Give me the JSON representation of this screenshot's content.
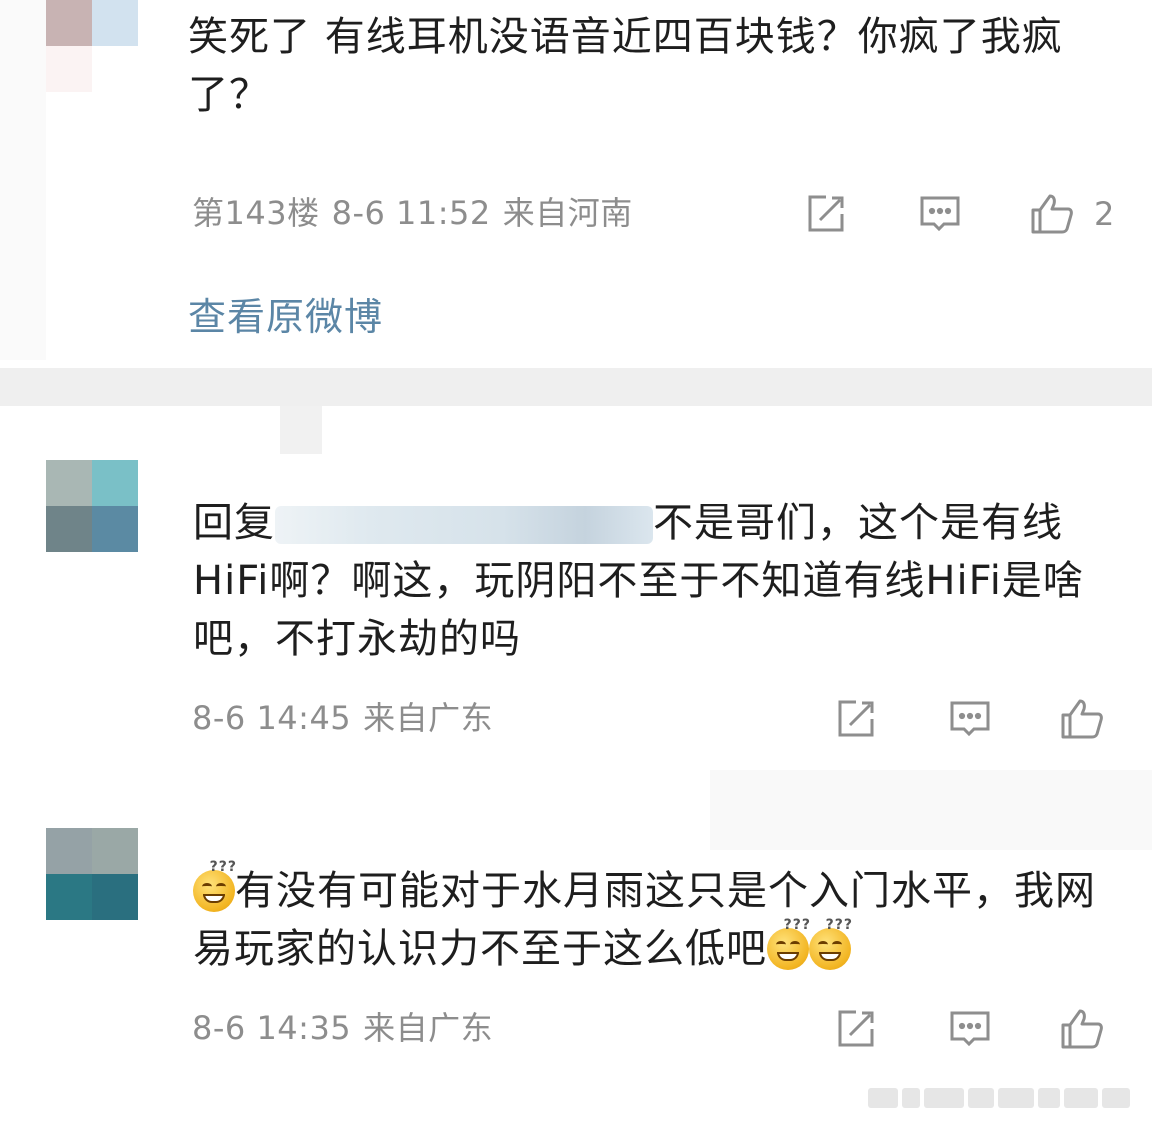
{
  "comments": [
    {
      "text": "笑死了 有线耳机没语音近四百块钱？你疯了我疯了？",
      "floor": "第143楼",
      "time": "8-6 11:52",
      "location": "来自河南",
      "likes": "2",
      "avatar_colors": [
        "#c8b3b3",
        "#d2e2ef",
        "#fbf3f3",
        "#ffffff"
      ]
    },
    {
      "reply_prefix": "回复",
      "text": "不是哥们，这个是有线HiFi啊？啊这，玩阴阳不至于不知道有线HiFi是啥吧，不打永劫的吗",
      "time": "8-6 14:45",
      "location": "来自广东",
      "avatar_colors": [
        "#a9b7b4",
        "#7ac0c7",
        "#6f8489",
        "#5b8aa3"
      ]
    },
    {
      "text": "有没有可能对于水月雨这只是个入门水平，我网易玩家的认识力不至于这么低吧",
      "time": "8-6 14:35",
      "location": "来自广东",
      "avatar_colors": [
        "#95a2a6",
        "#9aa8a6",
        "#2b7884",
        "#2a6f7f"
      ]
    }
  ],
  "view_original": "查看原微博",
  "icons": {
    "edit": "edit-icon",
    "comment": "comment-icon",
    "like": "thumbs-up-icon",
    "emoji": "grinning-sweat-emoji"
  },
  "colors": {
    "link": "#5b86a6",
    "meta": "#8d8d8d",
    "icon": "#8e8e8e",
    "divider": "#efefef"
  }
}
